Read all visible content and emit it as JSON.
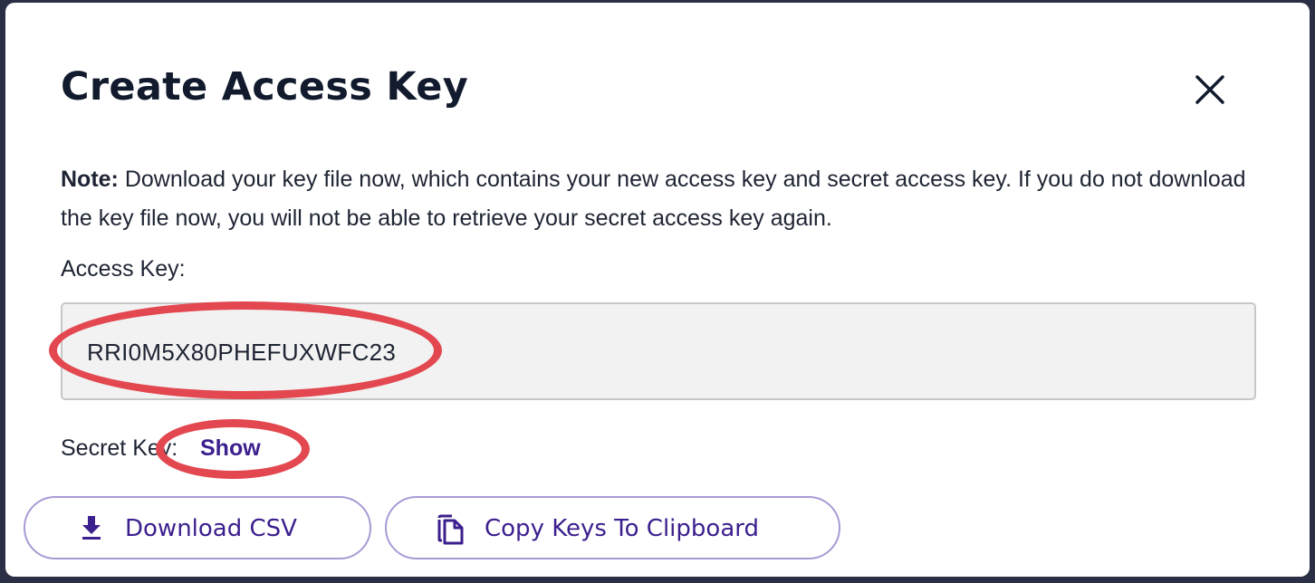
{
  "dialog": {
    "title": "Create Access Key",
    "close_icon": "close-icon",
    "note": {
      "label": "Note:",
      "text": " Download your key file now, which contains your new access key and secret access key. If you do not download the key file now, you will not be able to retrieve your secret access key again."
    },
    "access_key": {
      "label": "Access Key:",
      "value": "RRI0M5X80PHEFUXWFC23"
    },
    "secret_key": {
      "label": "Secret Key:",
      "show_label": "Show"
    },
    "buttons": {
      "download": {
        "label": "Download CSV",
        "icon": "download-icon"
      },
      "copy": {
        "label": "Copy Keys To Clipboard",
        "icon": "copy-icon"
      }
    }
  },
  "colors": {
    "accent": "#3c1f8e",
    "annotation": "#e3474f",
    "title": "#111b2d",
    "field_background": "#f2f2f2"
  }
}
